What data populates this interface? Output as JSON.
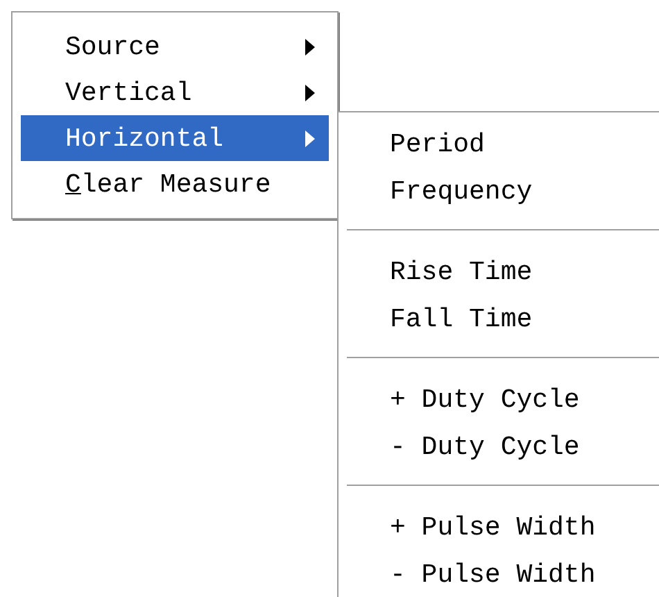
{
  "menu": {
    "items": [
      {
        "label": "Source",
        "has_submenu": true,
        "selected": false
      },
      {
        "label": "Vertical",
        "has_submenu": true,
        "selected": false
      },
      {
        "label": "Horizontal",
        "has_submenu": true,
        "selected": true
      },
      {
        "label": "Clear Measure",
        "has_submenu": false,
        "selected": false,
        "first_letter_underlined": true
      }
    ]
  },
  "submenu": {
    "items": [
      {
        "kind": "item",
        "label": "Period"
      },
      {
        "kind": "item",
        "label": "Frequency"
      },
      {
        "kind": "separator"
      },
      {
        "kind": "item",
        "label": "Rise Time"
      },
      {
        "kind": "item",
        "label": "Fall Time"
      },
      {
        "kind": "separator"
      },
      {
        "kind": "item",
        "label": "+ Duty Cycle"
      },
      {
        "kind": "item",
        "label": "- Duty Cycle"
      },
      {
        "kind": "separator"
      },
      {
        "kind": "item",
        "label": "+ Pulse Width"
      },
      {
        "kind": "item",
        "label": "- Pulse Width"
      }
    ]
  }
}
